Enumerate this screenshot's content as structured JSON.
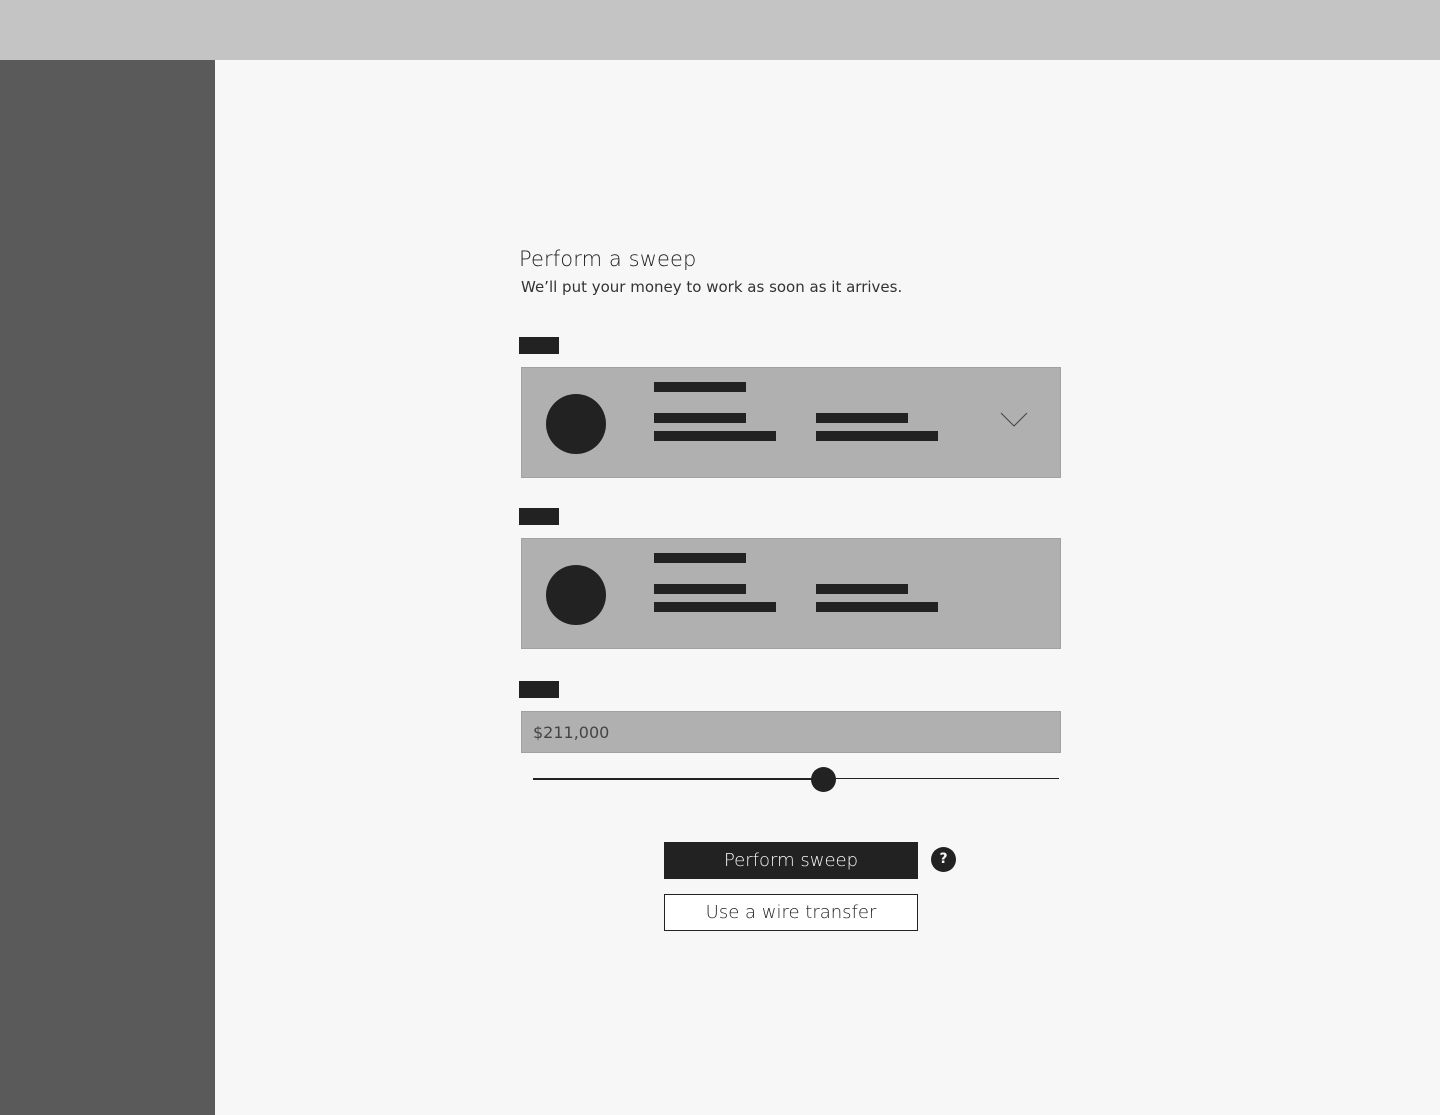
{
  "form": {
    "title": "Perform a sweep",
    "subtitle": "We’ll put your money to work as soon as it arrives.",
    "amount": {
      "value": "$211,000",
      "slider_fraction": 0.551
    },
    "from_account": {
      "icon": "chevron-down-icon"
    },
    "help_icon": "?",
    "primary_button": "Perform sweep",
    "secondary_button": "Use a wire transfer"
  },
  "colors": {
    "topbar": "#c4c4c4",
    "sidebar": "#5a5a5a",
    "background": "#f7f7f7",
    "card": "#b0b0b0",
    "ink": "#222222"
  }
}
